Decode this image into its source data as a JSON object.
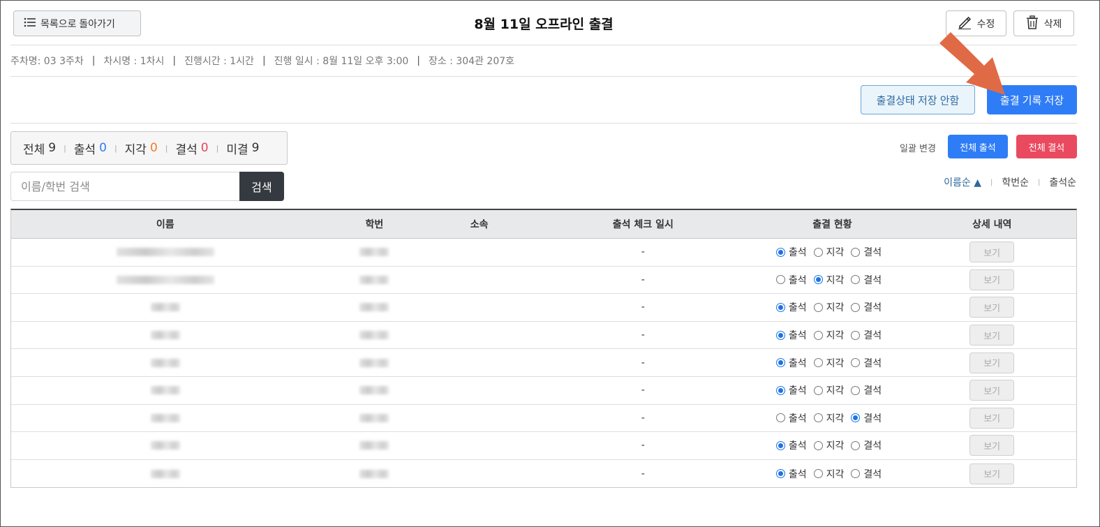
{
  "header": {
    "back_label": "목록으로 돌아가기",
    "title": "8월 11일 오프라인 출결",
    "edit_label": "수정",
    "delete_label": "삭제"
  },
  "info": [
    "주차명: 03 3주차",
    "차시명 : 1차시",
    "진행시간 : 1시간",
    "진행 일시 : 8월 11일 오후 3:00",
    "장소 : 304관 207호"
  ],
  "info_separator": "|",
  "actions": {
    "no_save_label": "출결상태 저장 안함",
    "save_label": "출결 기록 저장"
  },
  "summary": {
    "total_label": "전체",
    "total": "9",
    "present_label": "출석",
    "present": "0",
    "late_label": "지각",
    "late": "0",
    "absent_label": "결석",
    "absent": "0",
    "unchecked_label": "미결",
    "unchecked": "9",
    "present_color": "#2f7df6",
    "late_color": "#f07b2b",
    "absent_color": "#e8435a"
  },
  "bulk": {
    "label": "일괄 변경",
    "all_present_label": "전체 출석",
    "all_absent_label": "전체 결석"
  },
  "search": {
    "placeholder": "이름/학번 검색",
    "button_label": "검색"
  },
  "sort": {
    "name_label": "이름순 ▲",
    "id_label": "학번순",
    "attendance_label": "출석순"
  },
  "table": {
    "columns": [
      "이름",
      "학번",
      "소속",
      "출석 체크 일시",
      "출결 현황",
      "상세 내역"
    ],
    "status_options": [
      "출석",
      "지각",
      "결석"
    ],
    "view_label": "보기",
    "rows": [
      {
        "check_time": "-",
        "status": 0
      },
      {
        "check_time": "-",
        "status": 1
      },
      {
        "check_time": "-",
        "status": 0
      },
      {
        "check_time": "-",
        "status": 0
      },
      {
        "check_time": "-",
        "status": 0
      },
      {
        "check_time": "-",
        "status": 0
      },
      {
        "check_time": "-",
        "status": 2
      },
      {
        "check_time": "-",
        "status": 0
      },
      {
        "check_time": "-",
        "status": 0
      }
    ]
  },
  "colors": {
    "primary": "#2f7df6",
    "danger": "#ea4a5f",
    "dark": "#343a40",
    "annotation_arrow": "#e06a45"
  }
}
